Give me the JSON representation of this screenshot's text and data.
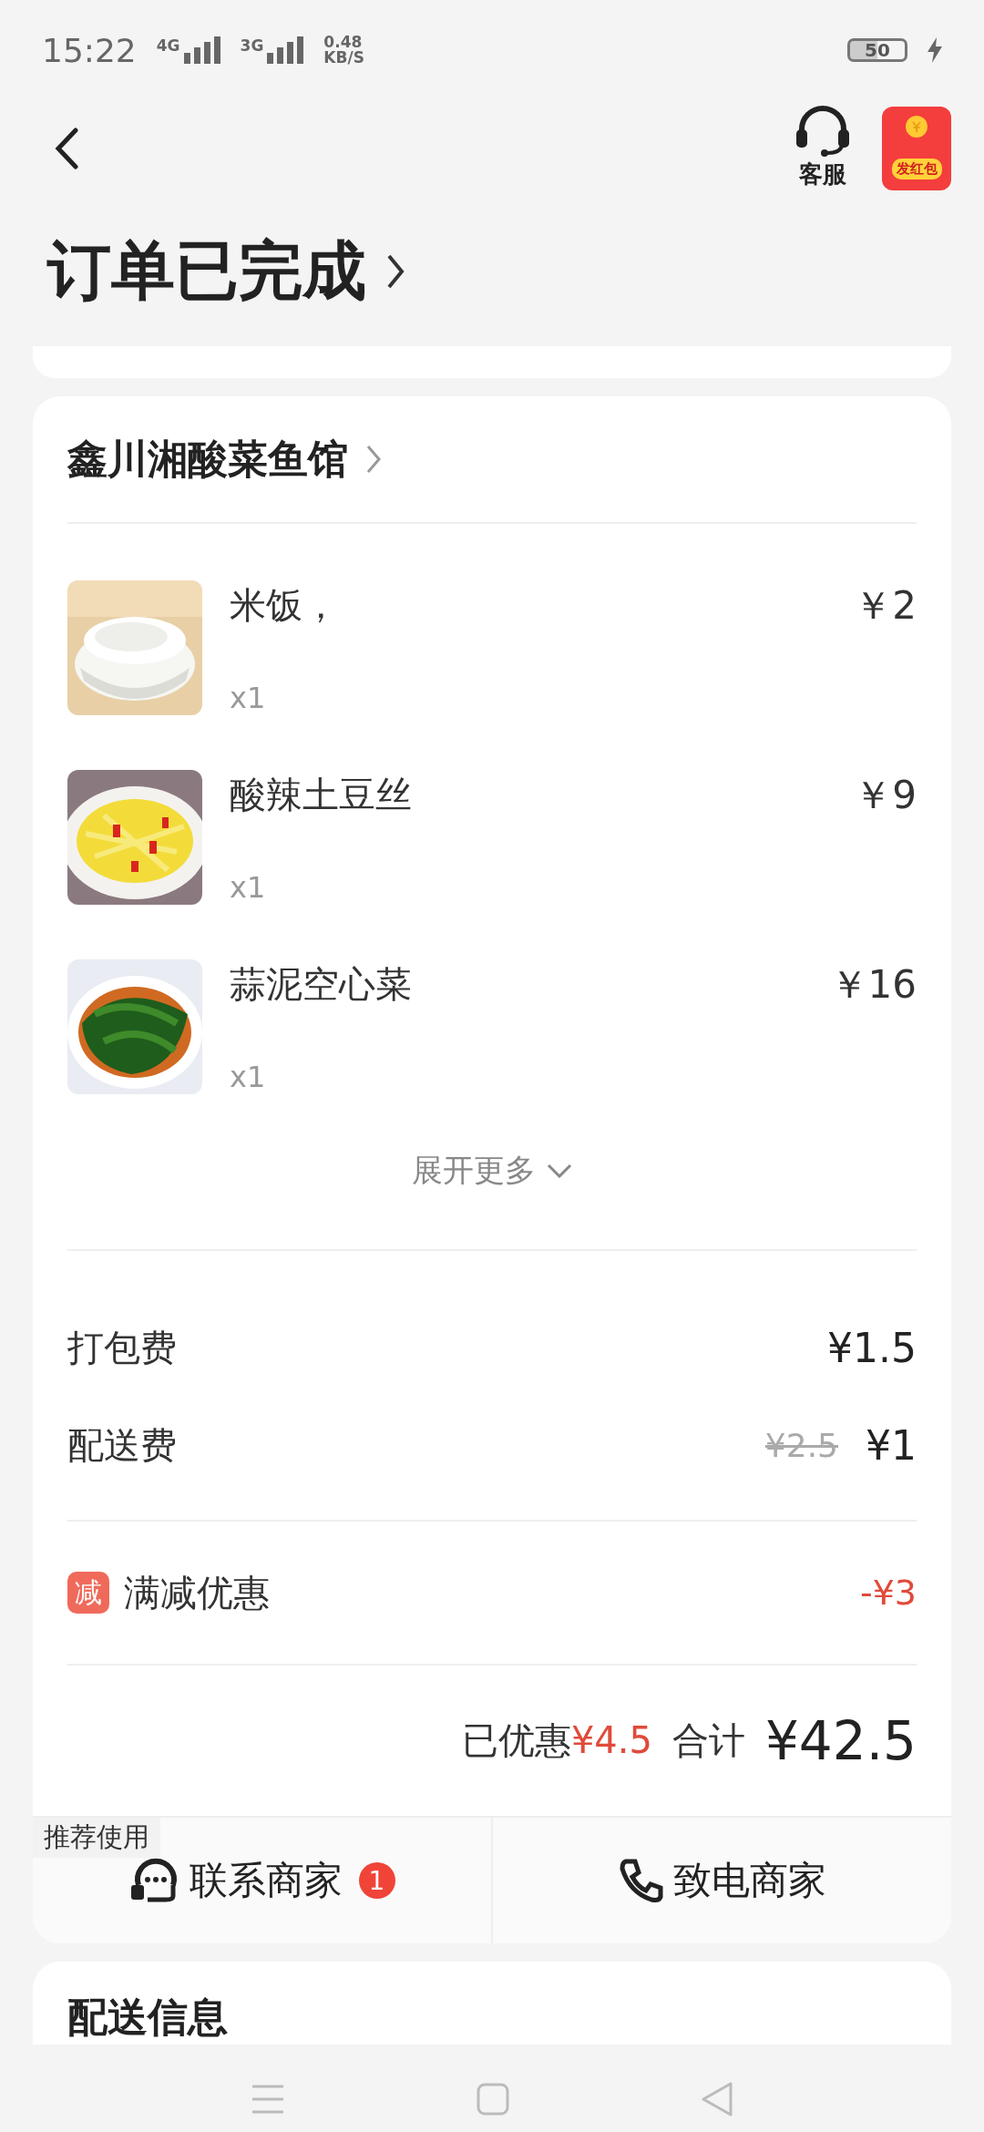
{
  "status_bar": {
    "time": "15:22",
    "networks": [
      {
        "label": "4G"
      },
      {
        "label": "3G"
      }
    ],
    "speed": "0.48",
    "speed_unit": "KB/S",
    "battery": "50"
  },
  "header": {
    "service_label": "客服",
    "red_packet_label": "发红包"
  },
  "title": "订单已完成",
  "store": {
    "name": "鑫川湘酸菜鱼馆",
    "items": [
      {
        "name": "米饭，",
        "quantity": "x1",
        "price": "￥2"
      },
      {
        "name": "酸辣土豆丝",
        "quantity": "x1",
        "price": "￥9"
      },
      {
        "name": "蒜泥空心菜",
        "quantity": "x1",
        "price": "￥16"
      }
    ],
    "expand_label": "展开更多",
    "fees": [
      {
        "label": "打包费",
        "price": "¥1.5"
      },
      {
        "label": "配送费",
        "original_price": "¥2.5",
        "price": "¥1"
      }
    ],
    "discount": {
      "badge": "减",
      "label": "满减优惠",
      "amount": "-¥3"
    },
    "summary": {
      "saved_label": "已优惠",
      "saved_amount": "¥4.5",
      "total_label": "合计",
      "total": "¥42.5"
    },
    "actions": [
      {
        "kind": "chat",
        "label": "联系商家",
        "badge": "1",
        "tag": "推荐使用"
      },
      {
        "kind": "phone",
        "label": "致电商家"
      }
    ]
  },
  "delivery": {
    "title": "配送信息"
  }
}
